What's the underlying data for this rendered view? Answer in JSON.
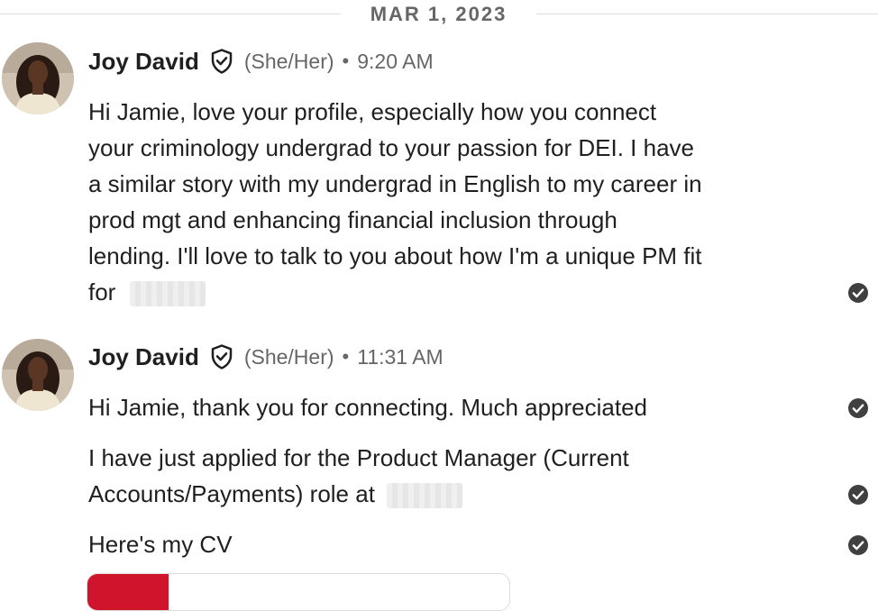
{
  "date_divider": "MAR 1, 2023",
  "messages": [
    {
      "sender": "Joy David",
      "pronouns": "(She/Her)",
      "time": "9:20 AM",
      "bubbles": [
        {
          "lines": [
            "Hi Jamie, love your profile, especially how you connect",
            "your criminology undergrad to your passion for DEI. I have",
            "a similar story with my undergrad in English to my career in",
            "prod mgt and enhancing financial inclusion through",
            "lending. I'll love to talk to you about how I'm a unique PM fit"
          ],
          "last_line": "for"
        }
      ]
    },
    {
      "sender": "Joy David",
      "pronouns": "(She/Her)",
      "time": "11:31 AM",
      "bubbles": [
        {
          "text": "Hi Jamie, thank you for connecting. Much appreciated"
        },
        {
          "line1": "I have just applied for the Product Manager (Current",
          "line2": "Accounts/Payments) role at"
        },
        {
          "text": "Here's my CV"
        }
      ]
    }
  ],
  "icons": {
    "verified": "shield-check-icon",
    "seen": "check-circle-icon",
    "attachment": "pdf-file-icon"
  },
  "colors": {
    "text": "#1f1f1f",
    "muted": "#666666",
    "seen_check": "#404040",
    "pdf_red": "#d0142c"
  }
}
